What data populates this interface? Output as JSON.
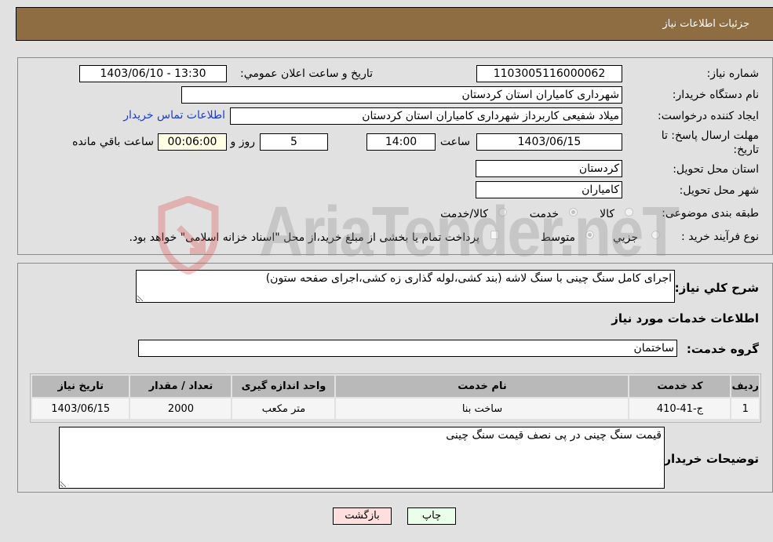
{
  "header": {
    "title": "جزئیات اطلاعات نیاز"
  },
  "details": {
    "need_number": {
      "label": "شماره نیاز:",
      "value": "1103005116000062"
    },
    "announce_datetime": {
      "label": "تاریخ و ساعت اعلان عمومي:",
      "value": "1403/06/10 - 13:30"
    },
    "buyer_org": {
      "label": "نام دستگاه خریدار:",
      "value": "شهرداری کامیاران استان کردستان"
    },
    "requester": {
      "label": "ایجاد کننده درخواست:",
      "value": "میلاد شفیعی کاربرداز شهرداری کامیاران استان کردستان"
    },
    "contact_link": "اطلاعات تماس خریدار",
    "deadline": {
      "label_line1": "مهلت ارسال پاسخ: تا",
      "label_line2": "تاریخ:",
      "date": "1403/06/15",
      "time_label": "ساعت",
      "time": "14:00",
      "days": "5",
      "days_label": "روز و",
      "remaining": "00:06:00",
      "remaining_label": "ساعت باقي مانده"
    },
    "delivery_province": {
      "label": "استان محل تحویل:",
      "value": "کردستان"
    },
    "delivery_city": {
      "label": "شهر محل تحویل:",
      "value": "کامیاران"
    },
    "category": {
      "label": "طبقه بندی موضوعی:",
      "options": [
        "کالا",
        "خدمت",
        "کالا/خدمت"
      ],
      "selected": "خدمت"
    },
    "purchase_type": {
      "label": "نوع فرآیند خرید :",
      "options": [
        "جزيي",
        "متوسط"
      ],
      "selected": "متوسط",
      "treasury_note": "پرداخت تمام یا بخشی از مبلغ خرید،از محل \"اسناد خزانه اسلامی\" خواهد بود.",
      "treasury_checked": false
    }
  },
  "description": {
    "label": "شرح کلي نیاز:",
    "value": "اجرای کامل سنگ چینی با سنگ لاشه (بند کشی،لوله گذاری زه کشی،اجرای صفحه ستون)"
  },
  "services": {
    "section_title": "اطلاعات خدمات مورد نیاز",
    "group_label": "گروه خدمت:",
    "group_value": "ساختمان",
    "table": {
      "headers": [
        "ردیف",
        "کد خدمت",
        "نام خدمت",
        "واحد اندازه گیری",
        "تعداد / مقدار",
        "تاریخ نیاز"
      ],
      "rows": [
        [
          "1",
          "ج-41-410",
          "ساخت بنا",
          "متر مکعب",
          "2000",
          "1403/06/15"
        ]
      ]
    }
  },
  "buyer_notes": {
    "label": "توضیحات خریدار:",
    "value": "قیمت سنگ چینی در پی نصف قیمت سنگ چینی"
  },
  "buttons": {
    "print": "چاپ",
    "back": "بازگشت"
  },
  "watermark": "AriaTender.neT",
  "colors": {
    "header_bg": "#8f6d42",
    "link": "#1a3cd6",
    "print_bg": "#eaffea",
    "back_bg": "#ffdede",
    "remaining_bg": "#ffffe5"
  }
}
